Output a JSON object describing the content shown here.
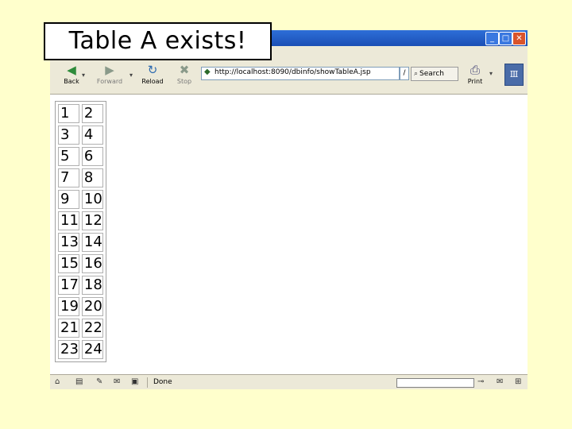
{
  "slide": {
    "title": "Table A exists!"
  },
  "browser": {
    "menu_text": "e",
    "toolbar": {
      "back_label": "Back",
      "forward_label": "Forward",
      "reload_label": "Reload",
      "stop_label": "Stop",
      "search_label": "Search",
      "print_label": "Print"
    },
    "address": {
      "value": "http://localhost:8090/dbinfo/showTableA.jsp"
    },
    "status": {
      "text": "Done"
    }
  },
  "table_a": {
    "rows": [
      [
        "1",
        "2"
      ],
      [
        "3",
        "4"
      ],
      [
        "5",
        "6"
      ],
      [
        "7",
        "8"
      ],
      [
        "9",
        "10"
      ],
      [
        "11",
        "12"
      ],
      [
        "13",
        "14"
      ],
      [
        "15",
        "16"
      ],
      [
        "17",
        "18"
      ],
      [
        "19",
        "20"
      ],
      [
        "21",
        "22"
      ],
      [
        "23",
        "24"
      ]
    ]
  }
}
